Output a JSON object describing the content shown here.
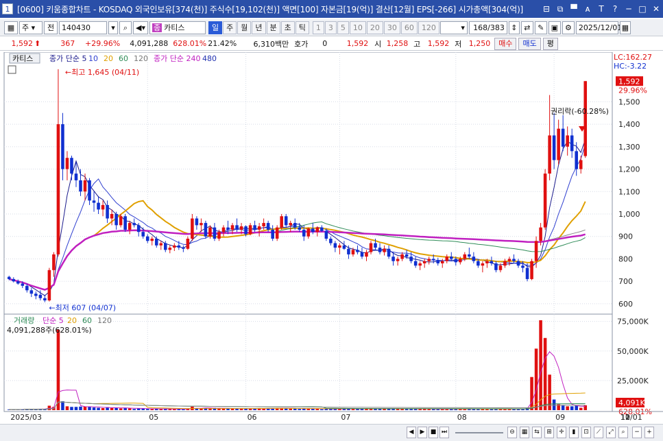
{
  "window": {
    "number": "1",
    "title": "[0600] 키움종합차트 - KOSDAQ 외국인보유[374(천)] 주식수[19,102(천)] 액면[100] 자본금[19(억)] 결산[12월] EPS[-266] 시가총액[304(억)]",
    "buttons": [
      "⊟",
      "⧉",
      "▀",
      "ᴀ",
      "T",
      "?",
      "─",
      "□",
      "✕"
    ]
  },
  "toolbar": {
    "type_select": "주",
    "all_label": "전",
    "code": "140430",
    "name": "카티스",
    "periods": [
      {
        "label": "일",
        "selected": true
      },
      {
        "label": "주",
        "selected": false
      },
      {
        "label": "월",
        "selected": false
      },
      {
        "label": "년",
        "selected": false
      },
      {
        "label": "분",
        "selected": false
      },
      {
        "label": "초",
        "selected": false
      },
      {
        "label": "틱",
        "selected": false
      }
    ],
    "intervals": [
      "1",
      "3",
      "5",
      "10",
      "20",
      "30",
      "60",
      "120"
    ],
    "count": "168/383",
    "date": "2025/12/01"
  },
  "quote": {
    "price": "1,592",
    "change": "367",
    "change_pct": "+29.96%",
    "volume": "4,091,288",
    "vol_pct": "628.01%",
    "turnover": "21.42%",
    "amount": "6,310백만",
    "hoga_label": "호가",
    "hoga": "0",
    "hoga_price": "1,592",
    "open_label": "시",
    "open": "1,258",
    "high_label": "고",
    "high": "1,592",
    "low_label": "저",
    "low": "1,250",
    "buy": "매수",
    "sell": "매도",
    "eval": "평"
  },
  "chart_data": {
    "type": "candlestick",
    "price_panel": {
      "name_tab": "카티스",
      "legend": [
        {
          "text": "종가 단순 5",
          "color": "#1a1a8c"
        },
        {
          "text": "10",
          "color": "#3040d0"
        },
        {
          "text": "20",
          "color": "#e0a000"
        },
        {
          "text": "60",
          "color": "#2e8b57"
        },
        {
          "text": "120",
          "color": "#777777"
        },
        {
          "text": "종가 단순 240",
          "color": "#c020c0"
        },
        {
          "text": "480",
          "color": "#2030b0"
        }
      ],
      "y_ticks": [
        600,
        700,
        800,
        900,
        1000,
        1100,
        1200,
        1300,
        1400,
        1500
      ],
      "ylim": [
        560,
        1660
      ],
      "lc": "LC:162.27",
      "hc": "HC:-3.22",
      "last_price": "1,592",
      "last_pct": "29.96%",
      "max_label": "최고 1,645 (04/11)",
      "min_label": "최저 607 (04/07)",
      "rights_label": "권리락(-60.28%)"
    },
    "volume_panel": {
      "legend_title": "거래량",
      "legend": [
        {
          "text": "단순 5",
          "color": "#c020c0"
        },
        {
          "text": "20",
          "color": "#e0a000"
        },
        {
          "text": "60",
          "color": "#2e8b57"
        },
        {
          "text": "120",
          "color": "#777777"
        }
      ],
      "current": "4,091,288주(628.01%)",
      "y_ticks": [
        "25,000K",
        "50,000K",
        "75,000K"
      ],
      "y_values": [
        25000,
        50000,
        75000
      ],
      "ylim": [
        0,
        80000
      ],
      "last_volume": "4,091K",
      "last_pct": "628.01%"
    },
    "x_labels": [
      {
        "label": "2025/03",
        "index": 0
      },
      {
        "label": "05",
        "index": 31
      },
      {
        "label": "06",
        "index": 53
      },
      {
        "label": "07",
        "index": 74
      },
      {
        "label": "08",
        "index": 100
      },
      {
        "label": "09",
        "index": 122
      },
      {
        "label": "10",
        "index": 148
      },
      {
        "label": "11",
        "index": 166
      },
      {
        "label": "12",
        "index": 188
      },
      {
        "label": "12/01",
        "index": 198
      }
    ],
    "candles": [
      [
        720,
        725,
        705,
        710
      ],
      [
        710,
        718,
        695,
        700
      ],
      [
        700,
        708,
        685,
        690
      ],
      [
        690,
        700,
        670,
        680
      ],
      [
        680,
        690,
        650,
        660
      ],
      [
        660,
        670,
        630,
        645
      ],
      [
        645,
        655,
        620,
        635
      ],
      [
        640,
        660,
        615,
        625
      ],
      [
        625,
        640,
        607,
        615
      ],
      [
        615,
        760,
        610,
        750
      ],
      [
        750,
        830,
        720,
        820
      ],
      [
        820,
        1645,
        810,
        1400
      ],
      [
        1400,
        1450,
        1150,
        1200
      ],
      [
        1200,
        1280,
        1150,
        1250
      ],
      [
        1250,
        1260,
        1150,
        1180
      ],
      [
        1180,
        1230,
        1120,
        1150
      ],
      [
        1150,
        1200,
        1080,
        1100
      ],
      [
        1100,
        1180,
        1060,
        1150
      ],
      [
        1150,
        1160,
        1040,
        1060
      ],
      [
        1060,
        1100,
        1010,
        1050
      ],
      [
        1050,
        1080,
        1000,
        1020
      ],
      [
        1020,
        1060,
        990,
        1040
      ],
      [
        1040,
        1060,
        960,
        980
      ],
      [
        980,
        1020,
        950,
        1000
      ],
      [
        1000,
        1010,
        930,
        950
      ],
      [
        950,
        1000,
        940,
        990
      ],
      [
        990,
        1000,
        920,
        930
      ],
      [
        930,
        970,
        910,
        960
      ],
      [
        960,
        980,
        940,
        950
      ],
      [
        950,
        960,
        900,
        920
      ],
      [
        920,
        940,
        890,
        900
      ],
      [
        900,
        910,
        870,
        880
      ],
      [
        880,
        900,
        860,
        890
      ],
      [
        890,
        900,
        850,
        860
      ],
      [
        860,
        880,
        840,
        870
      ],
      [
        870,
        880,
        830,
        840
      ],
      [
        840,
        860,
        825,
        850
      ],
      [
        850,
        870,
        835,
        860
      ],
      [
        860,
        880,
        840,
        850
      ],
      [
        850,
        860,
        830,
        845
      ],
      [
        845,
        900,
        840,
        890
      ],
      [
        890,
        1000,
        880,
        980
      ],
      [
        980,
        990,
        930,
        950
      ],
      [
        950,
        980,
        920,
        960
      ],
      [
        960,
        970,
        890,
        900
      ],
      [
        900,
        950,
        890,
        940
      ],
      [
        940,
        960,
        880,
        890
      ],
      [
        890,
        930,
        880,
        920
      ],
      [
        920,
        950,
        900,
        940
      ],
      [
        940,
        970,
        910,
        930
      ],
      [
        930,
        960,
        910,
        950
      ],
      [
        950,
        980,
        920,
        930
      ],
      [
        930,
        960,
        910,
        945
      ],
      [
        945,
        950,
        900,
        910
      ],
      [
        910,
        960,
        905,
        950
      ],
      [
        950,
        970,
        920,
        930
      ],
      [
        930,
        960,
        900,
        945
      ],
      [
        945,
        980,
        930,
        960
      ],
      [
        960,
        970,
        920,
        930
      ],
      [
        930,
        950,
        880,
        890
      ],
      [
        890,
        950,
        880,
        940
      ],
      [
        940,
        1000,
        930,
        990
      ],
      [
        990,
        1000,
        940,
        950
      ],
      [
        950,
        970,
        920,
        960
      ],
      [
        960,
        980,
        930,
        940
      ],
      [
        940,
        960,
        920,
        930
      ],
      [
        930,
        950,
        880,
        900
      ],
      [
        900,
        940,
        890,
        935
      ],
      [
        935,
        960,
        910,
        920
      ],
      [
        920,
        945,
        900,
        940
      ],
      [
        940,
        950,
        920,
        925
      ],
      [
        925,
        935,
        880,
        890
      ],
      [
        890,
        900,
        860,
        870
      ],
      [
        870,
        880,
        830,
        850
      ],
      [
        850,
        870,
        820,
        860
      ],
      [
        860,
        880,
        840,
        845
      ],
      [
        845,
        860,
        800,
        820
      ],
      [
        820,
        850,
        810,
        840
      ],
      [
        840,
        860,
        820,
        830
      ],
      [
        830,
        850,
        800,
        810
      ],
      [
        810,
        840,
        790,
        830
      ],
      [
        830,
        880,
        820,
        870
      ],
      [
        870,
        890,
        840,
        850
      ],
      [
        850,
        870,
        820,
        830
      ],
      [
        830,
        860,
        815,
        845
      ],
      [
        845,
        860,
        800,
        810
      ],
      [
        810,
        830,
        770,
        790
      ],
      [
        790,
        810,
        770,
        800
      ],
      [
        800,
        830,
        790,
        820
      ],
      [
        820,
        840,
        800,
        810
      ],
      [
        810,
        830,
        780,
        790
      ],
      [
        790,
        810,
        760,
        770
      ],
      [
        770,
        790,
        750,
        780
      ],
      [
        780,
        800,
        760,
        790
      ],
      [
        790,
        810,
        775,
        800
      ],
      [
        800,
        820,
        780,
        795
      ],
      [
        795,
        805,
        770,
        780
      ],
      [
        780,
        800,
        760,
        790
      ],
      [
        790,
        820,
        780,
        810
      ],
      [
        810,
        830,
        790,
        800
      ],
      [
        800,
        810,
        770,
        785
      ],
      [
        785,
        810,
        775,
        800
      ],
      [
        800,
        830,
        790,
        820
      ],
      [
        820,
        850,
        800,
        810
      ],
      [
        810,
        830,
        780,
        790
      ],
      [
        790,
        800,
        760,
        770
      ],
      [
        770,
        790,
        740,
        780
      ],
      [
        780,
        800,
        760,
        790
      ],
      [
        790,
        810,
        770,
        780
      ],
      [
        780,
        790,
        740,
        750
      ],
      [
        750,
        780,
        740,
        770
      ],
      [
        770,
        800,
        760,
        790
      ],
      [
        790,
        810,
        770,
        800
      ],
      [
        800,
        820,
        780,
        790
      ],
      [
        790,
        800,
        760,
        770
      ],
      [
        770,
        790,
        740,
        760
      ],
      [
        760,
        780,
        700,
        710
      ],
      [
        710,
        800,
        705,
        790
      ],
      [
        790,
        900,
        760,
        880
      ],
      [
        880,
        960,
        860,
        940
      ],
      [
        940,
        1200,
        930,
        1180
      ],
      [
        1180,
        1530,
        1150,
        1350
      ],
      [
        1350,
        1450,
        1200,
        1240
      ],
      [
        1240,
        1420,
        1220,
        1380
      ],
      [
        1380,
        1440,
        1280,
        1300
      ],
      [
        1300,
        1390,
        1260,
        1350
      ],
      [
        1350,
        1380,
        1250,
        1280
      ],
      [
        1280,
        1320,
        1170,
        1200
      ],
      [
        1200,
        1260,
        1180,
        1240
      ],
      [
        1258,
        1592,
        1250,
        1592
      ]
    ]
  }
}
